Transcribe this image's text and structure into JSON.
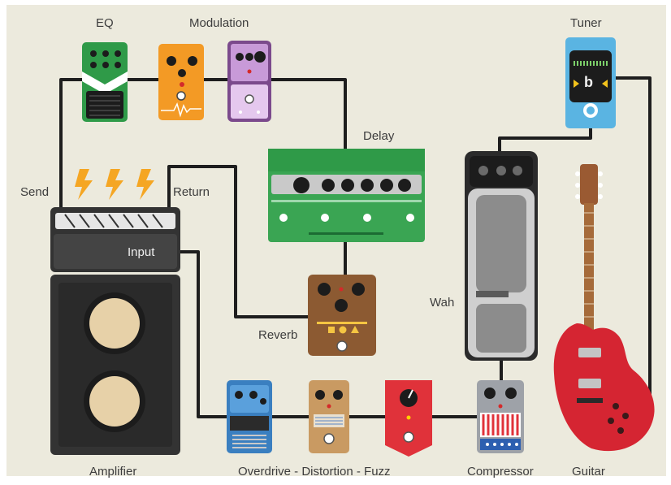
{
  "labels": {
    "eq": "EQ",
    "modulation": "Modulation",
    "tuner": "Tuner",
    "delay": "Delay",
    "send": "Send",
    "return": "Return",
    "input": "Input",
    "wah": "Wah",
    "reverb": "Reverb",
    "amplifier": "Amplifier",
    "drive_chain": "Overdrive - Distortion - Fuzz",
    "compressor": "Compressor",
    "guitar": "Guitar"
  },
  "tuner_display": {
    "note": "b"
  },
  "colors": {
    "background": "#eceadd",
    "cable": "#1e1e1e",
    "eq": "#2f9a48",
    "overdrive_orange": "#f39a25",
    "modulation_purple": "#c89ad8",
    "delay_green": "#3aa553",
    "tuner_blue": "#5ab4e2",
    "reverb_brown": "#8c5a32",
    "fuzz_red": "#e0323a",
    "compressor_gray": "#9ea2a8",
    "guitar_red": "#d52532",
    "amp_dark": "#3a3a3a",
    "spark_orange": "#f39a25",
    "blue_pedal": "#3a7fc0",
    "tan_pedal": "#c99a62"
  },
  "icons": [
    "lightning-bolt-icon",
    "speaker-cone-icon",
    "footswitch-icon",
    "control-knob-icon",
    "tuner-arrow-icon"
  ]
}
